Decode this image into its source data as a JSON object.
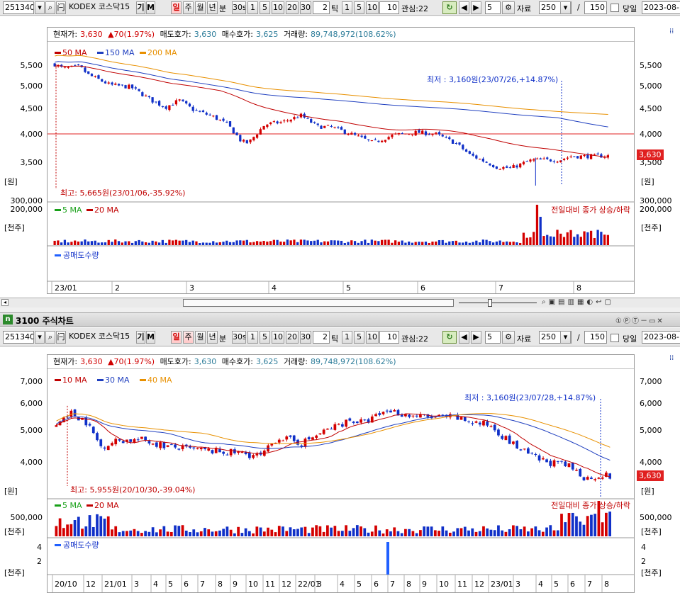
{
  "top": {
    "toolbar": {
      "code": "251340",
      "name": "KODEX 코스닥15",
      "gi": "기",
      "m": "M",
      "periods": [
        "일",
        "주",
        "월",
        "년",
        "분"
      ],
      "active_period": "일",
      "intervals": [
        "30s",
        "1",
        "5",
        "10",
        "20",
        "30"
      ],
      "tick_value": "2",
      "tick_label": "틱",
      "tick_intervals": [
        "1",
        "5",
        "10"
      ],
      "watch_label": "관심:22",
      "count": "5",
      "data_label": "자료",
      "data_count": "250",
      "slash": "/",
      "max_count": "150",
      "today_label": "당일",
      "date": "2023-08-"
    },
    "info": {
      "price_label": "현재가:",
      "price": "3,630",
      "change": "▲70(1.97%)",
      "ask_label": "매도호가:",
      "ask": "3,630",
      "bid_label": "매수호가:",
      "bid": "3,625",
      "vol_label": "거래량:",
      "vol": "89,748,972(108.62%)"
    },
    "legend_ma": [
      {
        "label": "50 MA",
        "color": "#c00000"
      },
      {
        "label": "150 MA",
        "color": "#1f3fbf"
      },
      {
        "label": "200 MA",
        "color": "#e89000"
      }
    ],
    "y_labels": [
      "5,500",
      "5,000",
      "4,500",
      "4,000",
      "3,500"
    ],
    "unit_won": "[원]",
    "low_note": "최저 : 3,160원(23/07/26,+14.87%)",
    "high_note": "최고: 5,665원(23/01/06,-35.92%)",
    "price_badge": "3,630",
    "vol_legend": [
      {
        "label": "5 MA",
        "color": "#18a018"
      },
      {
        "label": "20 MA",
        "color": "#c00000"
      }
    ],
    "vol_note": "전일대비 종가 상승/하락",
    "vol_labels": [
      "300,000",
      "200,000"
    ],
    "unit_k": "[천주]",
    "short_legend": "공매도수량",
    "x_labels": [
      "23/01",
      "2",
      "3",
      "4",
      "5",
      "6",
      "7",
      "8"
    ]
  },
  "window_title": "3100 주식차트",
  "bottom": {
    "info": {
      "price_label": "현재가:",
      "price": "3,630",
      "change": "▲70(1.97%)",
      "ask_label": "매도호가:",
      "ask": "3,630",
      "bid_label": "매수호가:",
      "bid": "3,625",
      "vol_label": "거래량:",
      "vol": "89,748,972(108.62%)"
    },
    "legend_ma": [
      {
        "label": "10 MA",
        "color": "#c00000"
      },
      {
        "label": "30 MA",
        "color": "#1f3fbf"
      },
      {
        "label": "40 MA",
        "color": "#e89000"
      }
    ],
    "y_labels": [
      "7,000",
      "6,000",
      "5,000",
      "4,000"
    ],
    "unit_won": "[원]",
    "low_note": "최저 : 3,160원(23/07/28,+14.87%)",
    "high_note": "최고: 5,955원(20/10/30,-39.04%)",
    "price_badge": "3,630",
    "vol_legend": [
      {
        "label": "5 MA",
        "color": "#18a018"
      },
      {
        "label": "20 MA",
        "color": "#c00000"
      }
    ],
    "vol_note": "전일대비 종가 상승/하락",
    "vol_labels": [
      "500,000"
    ],
    "unit_k": "[천주]",
    "short_legend": "공매도수량",
    "short_labels": [
      "4",
      "2"
    ],
    "x_labels": [
      "20/10",
      "12",
      "21/01",
      "3",
      "4",
      "5",
      "6",
      "7",
      "8",
      "9",
      "10",
      "11",
      "12",
      "22/01",
      "3",
      "4",
      "5",
      "6",
      "7",
      "8",
      "9",
      "10",
      "11",
      "12",
      "23/01",
      "3",
      "4",
      "5",
      "6",
      "7",
      "8"
    ]
  },
  "colors": {
    "up": "#d40000",
    "down": "#1030c8",
    "short": "#2060ff"
  }
}
